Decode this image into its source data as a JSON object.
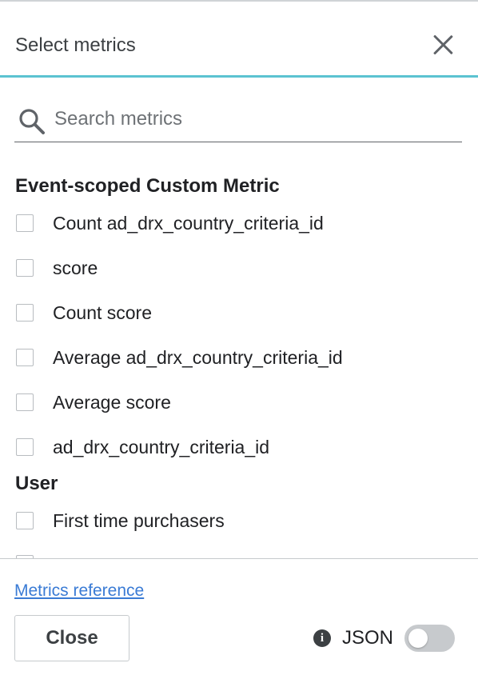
{
  "header": {
    "title": "Select metrics"
  },
  "search": {
    "placeholder": "Search metrics",
    "value": ""
  },
  "groups": [
    {
      "title": "Event-scoped Custom Metric",
      "items": [
        {
          "label": "Count ad_drx_country_criteria_id",
          "checked": false
        },
        {
          "label": "score",
          "checked": false
        },
        {
          "label": "Count score",
          "checked": false
        },
        {
          "label": "Average ad_drx_country_criteria_id",
          "checked": false
        },
        {
          "label": "Average score",
          "checked": false
        },
        {
          "label": "ad_drx_country_criteria_id",
          "checked": false
        }
      ]
    },
    {
      "title": "User",
      "items": [
        {
          "label": "First time purchasers",
          "checked": false
        },
        {
          "label": "",
          "checked": false
        }
      ]
    }
  ],
  "footer": {
    "reference_link": "Metrics reference",
    "close_label": "Close",
    "json_label": "JSON",
    "json_toggle_on": false
  },
  "colors": {
    "accent": "#5bc3d1",
    "link": "#3a7bd5"
  }
}
